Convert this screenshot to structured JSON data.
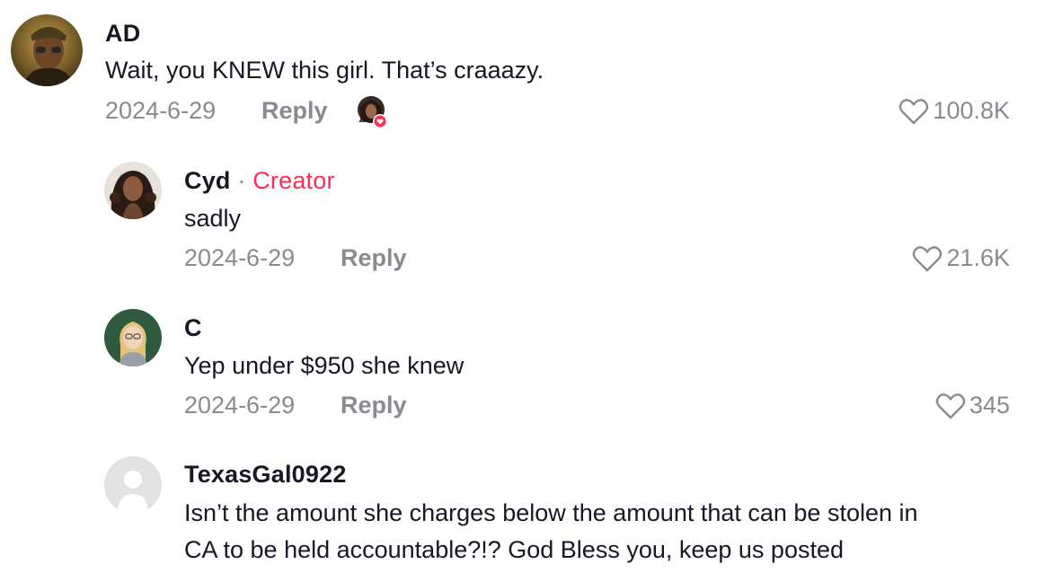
{
  "comments": [
    {
      "username": "AD",
      "text": "Wait, you KNEW this girl. That’s craaazy.",
      "date": "2024-6-29",
      "reply_label": "Reply",
      "likes": "100.8K",
      "liked_by_creator": true
    },
    {
      "username": "Cyd",
      "creator_separator": "·",
      "creator_label": "Creator",
      "text": "sadly",
      "date": "2024-6-29",
      "reply_label": "Reply",
      "likes": "21.6K"
    },
    {
      "username": "C",
      "text": "Yep under $950 she knew",
      "date": "2024-6-29",
      "reply_label": "Reply",
      "likes": "345"
    },
    {
      "username": "TexasGal0922",
      "text_lines": [
        "Isn’t the amount she charges below the amount that can be stolen in",
        "CA to be held accountable?!? God Bless you, keep us posted"
      ]
    }
  ],
  "colors": {
    "creator_accent": "#fe2c55",
    "meta_gray": "#8a8b91",
    "text": "#161823"
  },
  "icons": [
    "heart-outline-icon",
    "liked-heart-badge-icon",
    "default-avatar-icon"
  ]
}
